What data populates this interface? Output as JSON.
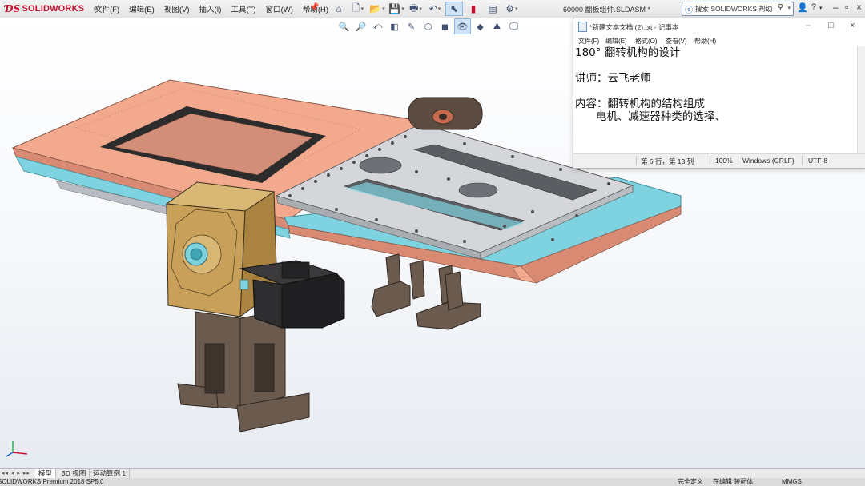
{
  "app": {
    "brand": "SOLIDWORKS",
    "document_title": "60000 翻板组件.SLDASM *",
    "menu": [
      "文件(F)",
      "编辑(E)",
      "视图(V)",
      "插入(I)",
      "工具(T)",
      "窗口(W)",
      "帮助(H)"
    ],
    "search_placeholder": "搜索 SOLIDWORKS 帮助",
    "toolbar_icons": [
      "home-icon",
      "new-icon",
      "open-icon",
      "save-icon",
      "print-icon",
      "undo-icon",
      "select-icon",
      "rebuild-icon",
      "file-properties-icon",
      "options-icon"
    ]
  },
  "notepad": {
    "title": "*新建文本文档 (2).txt - 记事本",
    "menu": [
      "文件(F)",
      "编辑(E)",
      "格式(O)",
      "查看(V)",
      "帮助(H)"
    ],
    "lines": [
      "180° 翻转机构的设计",
      "",
      "讲师：云飞老师",
      "",
      "内容：翻转机构的结构组成",
      "      电机、减速器种类的选择、"
    ],
    "status": {
      "position": "第 6 行，第 13 列",
      "zoom": "100%",
      "line_ending": "Windows (CRLF)",
      "encoding": "UTF-8"
    }
  },
  "tabs": [
    "模型",
    "3D 视图",
    "运动算例 1"
  ],
  "statusbar": {
    "version": "SOLIDWORKS Premium 2018 SP5.0",
    "state1": "完全定义",
    "state2": "在编辑 装配体",
    "units": "MMGS"
  },
  "colors": {
    "brand_red": "#c8102e",
    "copper_plate": "#f2a98e",
    "gray_plate": "#cfd1d4",
    "cyan_plate": "#7fd3e0",
    "gearbox": "#c8a05a",
    "motor": "#2e2e30",
    "bracket": "#6b5a4e"
  }
}
